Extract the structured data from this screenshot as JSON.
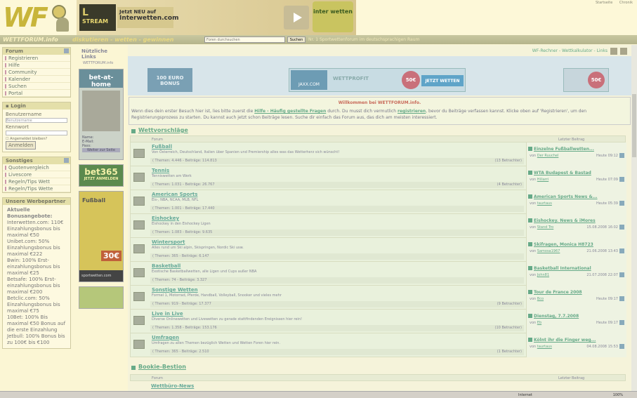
{
  "header": {
    "logo_text": "WF",
    "banner": {
      "stream_brand": "L",
      "stream_label": "STREAM",
      "tagline": "Jetzt NEU auf",
      "tagline_brand": "Interwetten.com",
      "partner_logo": "inter wetten"
    },
    "top_links": [
      "Startseite",
      "Chronik"
    ]
  },
  "navbar": {
    "site_name": "WETTFORUM.info",
    "slogan": "diskutieren - wetten - gewinnen",
    "search_placeholder": "Foren durchsuchen",
    "search_button": "Suchen",
    "ticker": "Nr. 1 Sportwettenforum im deutschsprachigen Raum"
  },
  "sidebar": {
    "forum_title": "Forum",
    "forum_items": [
      "Registrieren",
      "Hilfe",
      "Community",
      "Kalender",
      "Suchen",
      "Portal"
    ],
    "login": {
      "title": "Login",
      "user_label": "Benutzername",
      "user_placeholder": "Benutzername",
      "pass_label": "Kennwort",
      "remember": "Angemeldet bleiben?",
      "button": "Anmelden"
    },
    "misc_title": "Sonstiges",
    "misc_items": [
      "Quotenvergleich",
      "Livescore",
      "Regeln/Tips Wett",
      "Regeln/Tips Wette"
    ],
    "partner_title": "Unsere Werbepartner",
    "partner_heading": "Aktuelle Bonusangebote:",
    "partner_lines": [
      "Interwetten.com: 110€ Einzahlungsbonus bis maximal €50",
      "Unibet.com: 50% Einzahlungsbonus bis maximal €222",
      "Bwin: 100% Erst-einzahlungsbonus bis maximal €25",
      "Betsafe: 100% Erst-einzahlungsbonus bis maximal €200",
      "Betclic.com: 50% Einzahlungsbonus bis maximal €75",
      "10Bet: 100% Bis maximal €50 Bonus auf die erste Einzahlung",
      "Jetbull: 100% Bonus bis zu 100€ bis €100"
    ]
  },
  "midcol": {
    "title": "Nützliche Links",
    "sub": "WETTFORUM.info",
    "ad1": "bet-at-home",
    "ad1_fields": [
      "Name:",
      "E-Mail:",
      "Pass:"
    ],
    "ad1_button": "Weiter zur Seite",
    "ad2": "bet365",
    "ad2_sub": "JETZT ANMELDEN",
    "ad3_title": "Fußball",
    "ad3_value": "30€",
    "ad3_brand": "sportwetten.com"
  },
  "breadcrumb": {
    "right": "WF-Rechner - Wettkalkulator - Links"
  },
  "ads": {
    "bonus_left": "100 EURO BONUS",
    "mid_brand": "JAXX.COM",
    "mid_title": "WETTPROFIT",
    "mid_badge": "50€",
    "mid_button": "JETZT WETTEN",
    "right_badge": "50€"
  },
  "welcome": {
    "title": "Willkommen bei WETTFORUM.info.",
    "text_a": "Wenn dies dein erster Besuch hier ist, lies bitte zuerst die",
    "faq": "Hilfe - Häufig gestellte Fragen",
    "text_b": "durch. Du musst dich vermutlich",
    "register": "registrieren",
    "text_c": ", bevor du Beiträge verfassen kannst. Klicke oben auf 'Registrieren', um den Registrierungsprozess zu starten. Du kannst auch jetzt schon Beiträge lesen. Suche dir einfach das Forum aus, das dich am meisten interessiert."
  },
  "categories": [
    {
      "name": "Wettvorschläge",
      "col_forum": "Forum",
      "col_last": "Letzter Beitrag"
    },
    {
      "name": "Bookie-Bestion",
      "col_forum": "Forum",
      "col_last": "Letzter Beitrag"
    }
  ],
  "forums": [
    {
      "name": "Fußball",
      "desc": "Von Österreich, Deutschland, Italien über Spanien und Premiership alles was das Wetterherz sich wünscht!",
      "stats": "( Themen: 4.446 - Beiträge: 114.813",
      "viewers": "(13 Betrachter)",
      "last_title": "Einzelne Fußballwetten...",
      "last_by": "Der Ruuchel",
      "last_date": "Heute 09:12"
    },
    {
      "name": "Tennis",
      "desc": "Tenniswetten am Werk",
      "stats": "( Themen: 1.031 - Beiträge: 26.767",
      "viewers": "(4 Betrachter)",
      "last_title": "WTA Budapest & Bastad",
      "last_by": "Hiliarri",
      "last_date": "Heute 07:09"
    },
    {
      "name": "American Sports",
      "desc": "Eis-, NBA, NCAA, MLB, NFL",
      "stats": "( Themen: 1.001 - Beiträge: 17.440",
      "viewers": "",
      "last_title": "American Sports News &...",
      "last_by": "taurtaus",
      "last_date": "Heute 05:39"
    },
    {
      "name": "Eishockey",
      "desc": "Eishockey in den Eishockey Ligen",
      "stats": "( Themen: 1.083 - Beiträge: 9.635",
      "viewers": "",
      "last_title": "Eishockey. News & iMores",
      "last_by": "Stand Tro",
      "last_date": "15.08.2008 16:02"
    },
    {
      "name": "Wintersport",
      "desc": "Alles rund um Ski alpin, Skispringen, Nordic Ski usw.",
      "stats": "( Themen: 365 - Beiträge: 6.147",
      "viewers": "",
      "last_title": "Skifragen, Monica H8723",
      "last_by": "Samosa1967",
      "last_date": "21.06.2008 13:43"
    },
    {
      "name": "Basketball",
      "desc": "Exotische Basketballwetten, alle Ligen und Cups außer NBA",
      "stats": "( Themen: 74 - Beiträge: 3.327",
      "viewers": "",
      "last_title": "Basketball International",
      "last_by": "John81",
      "last_date": "21.07.2008 22:07"
    },
    {
      "name": "Sonstige Wetten",
      "desc": "Formel 1, Motorrad, Pferde, Handball, Volleyball, Snooker und vieles mehr",
      "stats": "( Themen: 919 - Beiträge: 17.377",
      "viewers": "(9 Betrachter)",
      "last_title": "Tour de France 2008",
      "last_by": "Bco",
      "last_date": "Heute 09:17"
    },
    {
      "name": "Live in Live",
      "desc": "Diverse Onlinewetten und Livewetten zu gerade stattfindenden Ereignissen hier rein!",
      "stats": "( Themen: 1.358 - Beiträge: 153.176",
      "viewers": "(10 Betrachter)",
      "last_title": "Dienstag, 7.7.2008",
      "last_by": "Eb",
      "last_date": "Heute 09:17"
    },
    {
      "name": "Umfragen",
      "desc": "Umfragen zu allen Themen bezüglich Wetten und Wetten Foren hier rein.",
      "stats": "( Themen: 365 - Beiträge: 2.510",
      "viewers": "(1 Betrachter)",
      "last_title": "Kölnt ihr die Finger weg...",
      "last_by": "taurtaus",
      "last_date": "04.08.2008 15:53"
    }
  ],
  "bookie_first_forum": "Wettbüro-News",
  "statusbar": {
    "zone": "Internet",
    "zoom": "100%"
  }
}
